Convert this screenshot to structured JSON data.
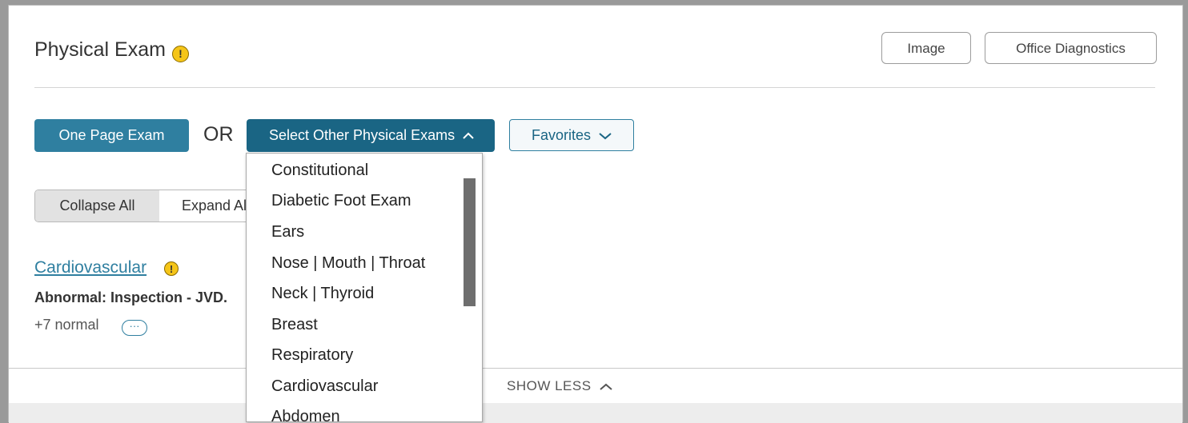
{
  "panel": {
    "title": "Physical Exam",
    "title_warning": "!",
    "buttons": {
      "image": "Image",
      "office_diagnostics": "Office Diagnostics"
    }
  },
  "selector": {
    "one_page_exam": "One Page Exam",
    "or_label": "OR",
    "select_other": "Select Other Physical Exams",
    "favorites": "Favorites"
  },
  "toggle": {
    "collapse_all": "Collapse All",
    "expand_all": "Expand All"
  },
  "section": {
    "title": "Cardiovascular",
    "warning": "!",
    "abnormal": "Abnormal: Inspection - JVD.",
    "normal_count": "+7 normal",
    "more": "···"
  },
  "dropdown": {
    "items": [
      "Constitutional",
      "Diabetic Foot Exam",
      "Ears",
      "Nose | Mouth | Throat",
      "Neck | Thyroid",
      "Breast",
      "Respiratory",
      "Cardiovascular",
      "Abdomen"
    ]
  },
  "footer": {
    "show_less": "SHOW LESS"
  },
  "icons": {
    "warning": "warning-icon",
    "chevron_up": "chevron-up-icon",
    "chevron_down": "chevron-down-icon",
    "more": "ellipsis-icon"
  },
  "colors": {
    "accent": "#2f7fa0",
    "accent_dark": "#1a6584",
    "warning": "#f5c518"
  }
}
